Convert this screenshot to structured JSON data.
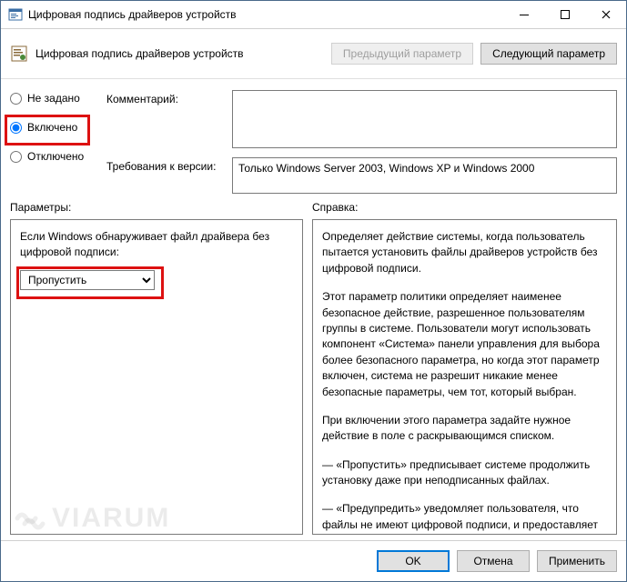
{
  "titlebar": {
    "title": "Цифровая подпись драйверов устройств"
  },
  "toolbar": {
    "doc_title": "Цифровая подпись драйверов устройств",
    "prev": "Предыдущий параметр",
    "next": "Следующий параметр"
  },
  "state": {
    "not_configured": "Не задано",
    "enabled": "Включено",
    "disabled": "Отключено",
    "selected": "enabled"
  },
  "fields": {
    "comment_label": "Комментарий:",
    "comment_value": "",
    "req_label": "Требования к версии:",
    "req_value": "Только Windows Server 2003, Windows XP и Windows 2000"
  },
  "lower": {
    "params_label": "Параметры:",
    "help_label": "Справка:"
  },
  "params": {
    "desc": "Если Windows обнаруживает файл драйвера без цифровой подписи:",
    "select_value": "Пропустить"
  },
  "help": {
    "p1": "Определяет действие системы, когда пользователь пытается установить файлы драйверов устройств без цифровой подписи.",
    "p2": "Этот параметр политики определяет наименее безопасное действие, разрешенное пользователям группы в системе. Пользователи могут использовать компонент «Система» панели управления для выбора более безопасного параметра, но когда этот параметр включен, система не разрешит никакие менее безопасные параметры, чем тот, который выбран.",
    "p3": "При включении этого параметра задайте нужное действие в поле с раскрывающимся списком.",
    "p4": "— «Пропустить» предписывает системе продолжить установку даже при неподписанных файлах.",
    "p5": "— «Предупредить» уведомляет пользователя, что файлы не имеют цифровой подписи, и предоставляет пользователю"
  },
  "footer": {
    "ok": "OK",
    "cancel": "Отмена",
    "apply": "Применить"
  },
  "watermark": "VIARUM",
  "colors": {
    "accent": "#0078d7",
    "hl": "#d11"
  }
}
